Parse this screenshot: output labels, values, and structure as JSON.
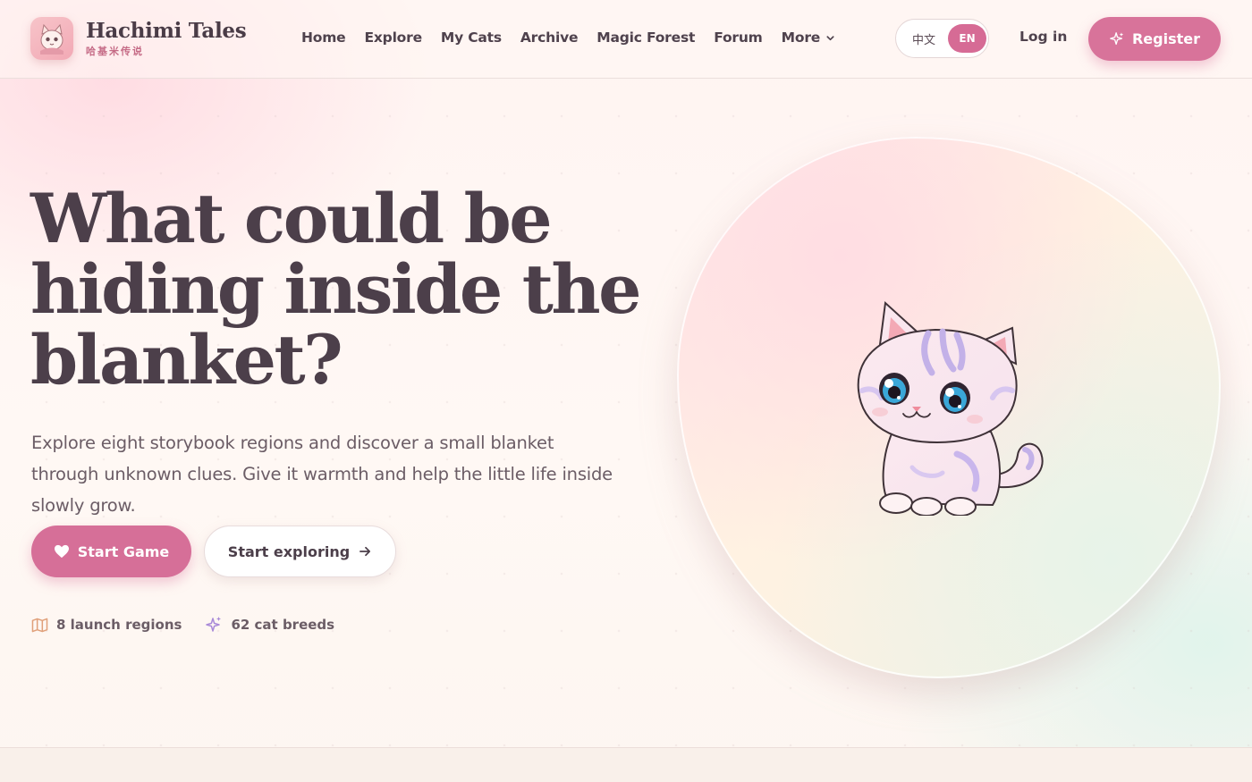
{
  "brand": {
    "name": "Hachimi Tales",
    "subtitle": "哈基米传说",
    "logo_icon": "cat-logo-icon"
  },
  "nav": {
    "items": [
      "Home",
      "Explore",
      "My Cats",
      "Archive",
      "Magic Forest",
      "Forum",
      "More"
    ]
  },
  "language": {
    "zh": "中文",
    "en": "EN",
    "active": "EN"
  },
  "auth": {
    "login": "Log in",
    "register": "Register"
  },
  "hero": {
    "title": "What could be hiding inside the blanket?",
    "description": "Explore eight storybook regions and discover a small blanket through unknown clues. Give it warmth and help the little life inside slowly grow.",
    "start_game": "Start Game",
    "start_exploring": "Start exploring"
  },
  "stats": [
    {
      "icon": "map-icon",
      "label": "8 launch regions"
    },
    {
      "icon": "sparkle-icon",
      "label": "62 cat breeds"
    }
  ],
  "colors": {
    "accent": "#d66f98",
    "text": "#4c3f4a",
    "muted": "#6b5d66"
  }
}
